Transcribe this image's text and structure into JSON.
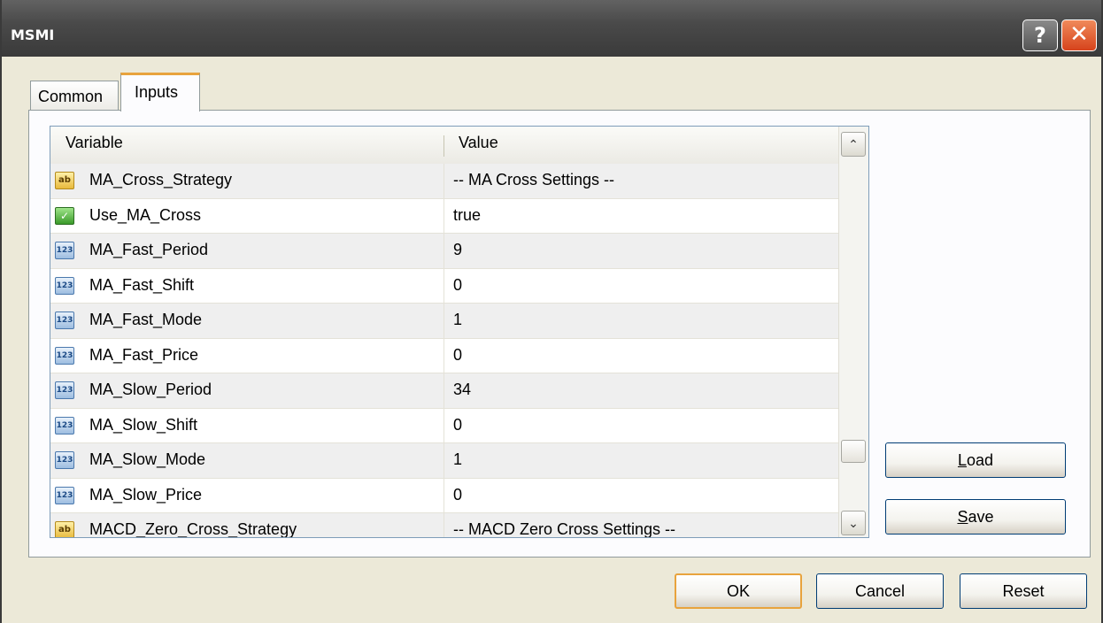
{
  "window": {
    "title": "MSMI",
    "help_glyph": "?",
    "close_glyph": "✕"
  },
  "tabs": [
    {
      "label": "Common",
      "active": false
    },
    {
      "label": "Inputs",
      "active": true
    }
  ],
  "grid": {
    "columns": [
      "Variable",
      "Value"
    ],
    "rows": [
      {
        "icon": "string-icon",
        "icon_text": "ab",
        "name": "MA_Cross_Strategy",
        "value": "-- MA Cross Settings --"
      },
      {
        "icon": "bool-icon",
        "icon_text": "✓",
        "name": "Use_MA_Cross",
        "value": "true"
      },
      {
        "icon": "number-icon",
        "icon_text": "123",
        "name": "MA_Fast_Period",
        "value": "9"
      },
      {
        "icon": "number-icon",
        "icon_text": "123",
        "name": "MA_Fast_Shift",
        "value": "0"
      },
      {
        "icon": "number-icon",
        "icon_text": "123",
        "name": "MA_Fast_Mode",
        "value": "1"
      },
      {
        "icon": "number-icon",
        "icon_text": "123",
        "name": "MA_Fast_Price",
        "value": "0"
      },
      {
        "icon": "number-icon",
        "icon_text": "123",
        "name": "MA_Slow_Period",
        "value": "34"
      },
      {
        "icon": "number-icon",
        "icon_text": "123",
        "name": "MA_Slow_Shift",
        "value": "0"
      },
      {
        "icon": "number-icon",
        "icon_text": "123",
        "name": "MA_Slow_Mode",
        "value": "1"
      },
      {
        "icon": "number-icon",
        "icon_text": "123",
        "name": "MA_Slow_Price",
        "value": "0"
      },
      {
        "icon": "string-icon",
        "icon_text": "ab",
        "name": "MACD_Zero_Cross_Strategy",
        "value": "-- MACD Zero Cross Settings --"
      }
    ],
    "scroll_up_glyph": "⌃",
    "scroll_down_glyph": "⌄"
  },
  "side_buttons": {
    "load_accel": "L",
    "load_rest": "oad",
    "save_accel": "S",
    "save_rest": "ave"
  },
  "footer": {
    "ok": "OK",
    "cancel": "Cancel",
    "reset": "Reset"
  },
  "colors": {
    "accent_orange": "#e8a33d",
    "titlebar": "#4a4a4a",
    "face": "#ece9d8"
  }
}
